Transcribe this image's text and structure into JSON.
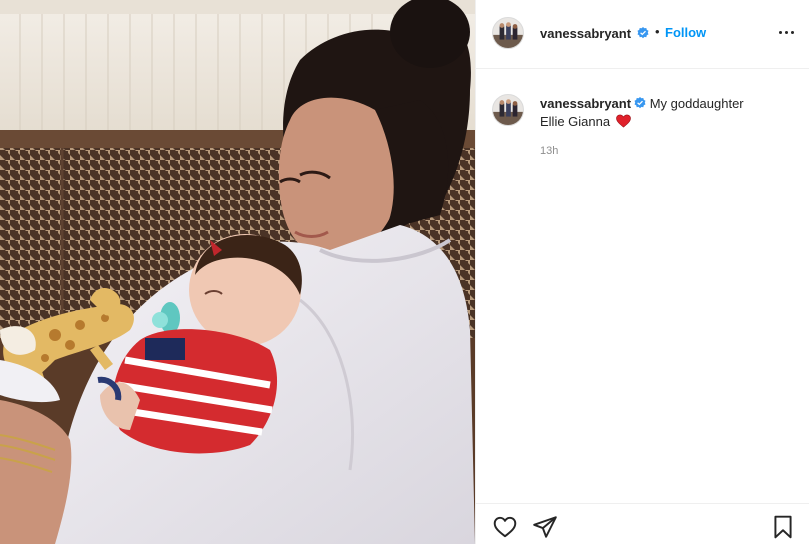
{
  "post": {
    "username": "vanessabryant",
    "verified": true,
    "separator": "•",
    "follow_label": "Follow",
    "caption": {
      "username": "vanessabryant",
      "text_line1": "My goddaughter",
      "text_line2": "Ellie Gianna",
      "emoji": "red-heart"
    },
    "timestamp": "13h"
  },
  "icons": {
    "more": "more-options-icon",
    "like": "heart-outline-icon",
    "share": "paper-plane-icon",
    "save": "bookmark-icon",
    "verified": "verified-badge-icon"
  },
  "colors": {
    "accent": "#0095f6",
    "verified": "#3897f0",
    "heart": "#e0212b",
    "muted": "#8e8e8e",
    "text": "#262626"
  }
}
